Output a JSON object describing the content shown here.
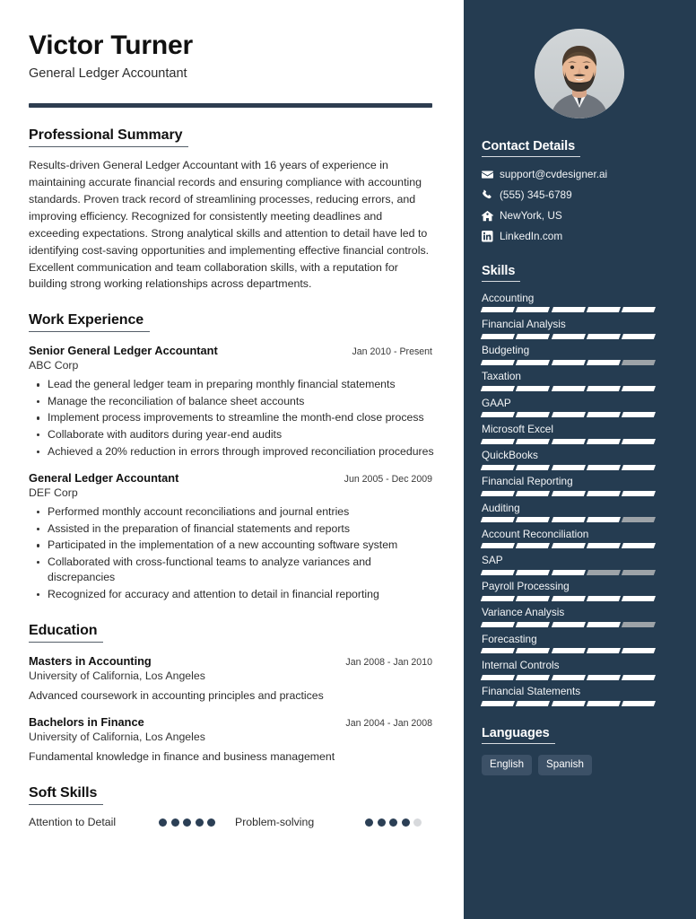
{
  "colors": {
    "sidebar_bg": "#253c51",
    "accent_rule": "#2e3d50",
    "chip_bg": "#3c5167",
    "dot_filled": "#2b3f55",
    "dot_empty": "#d7d9dc",
    "seg_filled": "#ffffff",
    "seg_empty": "#9da3a8"
  },
  "header": {
    "name": "Victor Turner",
    "job_title": "General Ledger Accountant"
  },
  "summary": {
    "heading": "Professional Summary",
    "text": "Results-driven General Ledger Accountant with 16 years of experience in maintaining accurate financial records and ensuring compliance with accounting standards. Proven track record of streamlining processes, reducing errors, and improving efficiency. Recognized for consistently meeting deadlines and exceeding expectations. Strong analytical skills and attention to detail have led to identifying cost-saving opportunities and implementing effective financial controls. Excellent communication and team collaboration skills, with a reputation for building strong working relationships across departments."
  },
  "work_experience": {
    "heading": "Work Experience",
    "entries": [
      {
        "title": "Senior General Ledger Accountant",
        "date": "Jan 2010 - Present",
        "company": "ABC Corp",
        "bullets": [
          "Lead the general ledger team in preparing monthly financial statements",
          "Manage the reconciliation of balance sheet accounts",
          "Implement process improvements to streamline the month-end close process",
          "Collaborate with auditors during year-end audits",
          "Achieved a 20% reduction in errors through improved reconciliation procedures"
        ]
      },
      {
        "title": "General Ledger Accountant",
        "date": "Jun 2005 - Dec 2009",
        "company": "DEF Corp",
        "bullets": [
          "Performed monthly account reconciliations and journal entries",
          "Assisted in the preparation of financial statements and reports",
          "Participated in the implementation of a new accounting software system",
          "Collaborated with cross-functional teams to analyze variances and discrepancies",
          "Recognized for accuracy and attention to detail in financial reporting"
        ]
      }
    ]
  },
  "education": {
    "heading": "Education",
    "entries": [
      {
        "degree": "Masters in Accounting",
        "date": "Jan 2008 - Jan 2010",
        "school": "University of California, Los Angeles",
        "description": "Advanced coursework in accounting principles and practices"
      },
      {
        "degree": "Bachelors in Finance",
        "date": "Jan 2004 - Jan 2008",
        "school": "University of California, Los Angeles",
        "description": "Fundamental knowledge in finance and business management"
      }
    ]
  },
  "soft_skills": {
    "heading": "Soft Skills",
    "items": [
      {
        "label": "Attention to Detail",
        "rating": 5,
        "max": 5
      },
      {
        "label": "Problem-solving",
        "rating": 4,
        "max": 5
      }
    ]
  },
  "contact": {
    "heading": "Contact Details",
    "items": [
      {
        "icon": "envelope-icon",
        "value": "support@cvdesigner.ai"
      },
      {
        "icon": "phone-icon",
        "value": "(555) 345-6789"
      },
      {
        "icon": "home-icon",
        "value": "NewYork, US"
      },
      {
        "icon": "linkedin-icon",
        "value": "LinkedIn.com"
      }
    ]
  },
  "skills": {
    "heading": "Skills",
    "items": [
      {
        "name": "Accounting",
        "level": 5,
        "max": 5
      },
      {
        "name": "Financial Analysis",
        "level": 5,
        "max": 5
      },
      {
        "name": "Budgeting",
        "level": 4,
        "max": 5
      },
      {
        "name": "Taxation",
        "level": 5,
        "max": 5
      },
      {
        "name": "GAAP",
        "level": 5,
        "max": 5
      },
      {
        "name": "Microsoft Excel",
        "level": 5,
        "max": 5
      },
      {
        "name": "QuickBooks",
        "level": 5,
        "max": 5
      },
      {
        "name": "Financial Reporting",
        "level": 5,
        "max": 5
      },
      {
        "name": "Auditing",
        "level": 4,
        "max": 5
      },
      {
        "name": "Account Reconciliation",
        "level": 5,
        "max": 5
      },
      {
        "name": "SAP",
        "level": 3,
        "max": 5
      },
      {
        "name": "Payroll Processing",
        "level": 5,
        "max": 5
      },
      {
        "name": "Variance Analysis",
        "level": 4,
        "max": 5
      },
      {
        "name": "Forecasting",
        "level": 5,
        "max": 5
      },
      {
        "name": "Internal Controls",
        "level": 5,
        "max": 5
      },
      {
        "name": "Financial Statements",
        "level": 5,
        "max": 5
      }
    ]
  },
  "languages": {
    "heading": "Languages",
    "items": [
      "English",
      "Spanish"
    ]
  },
  "avatar": {
    "alt": "profile-photo"
  }
}
